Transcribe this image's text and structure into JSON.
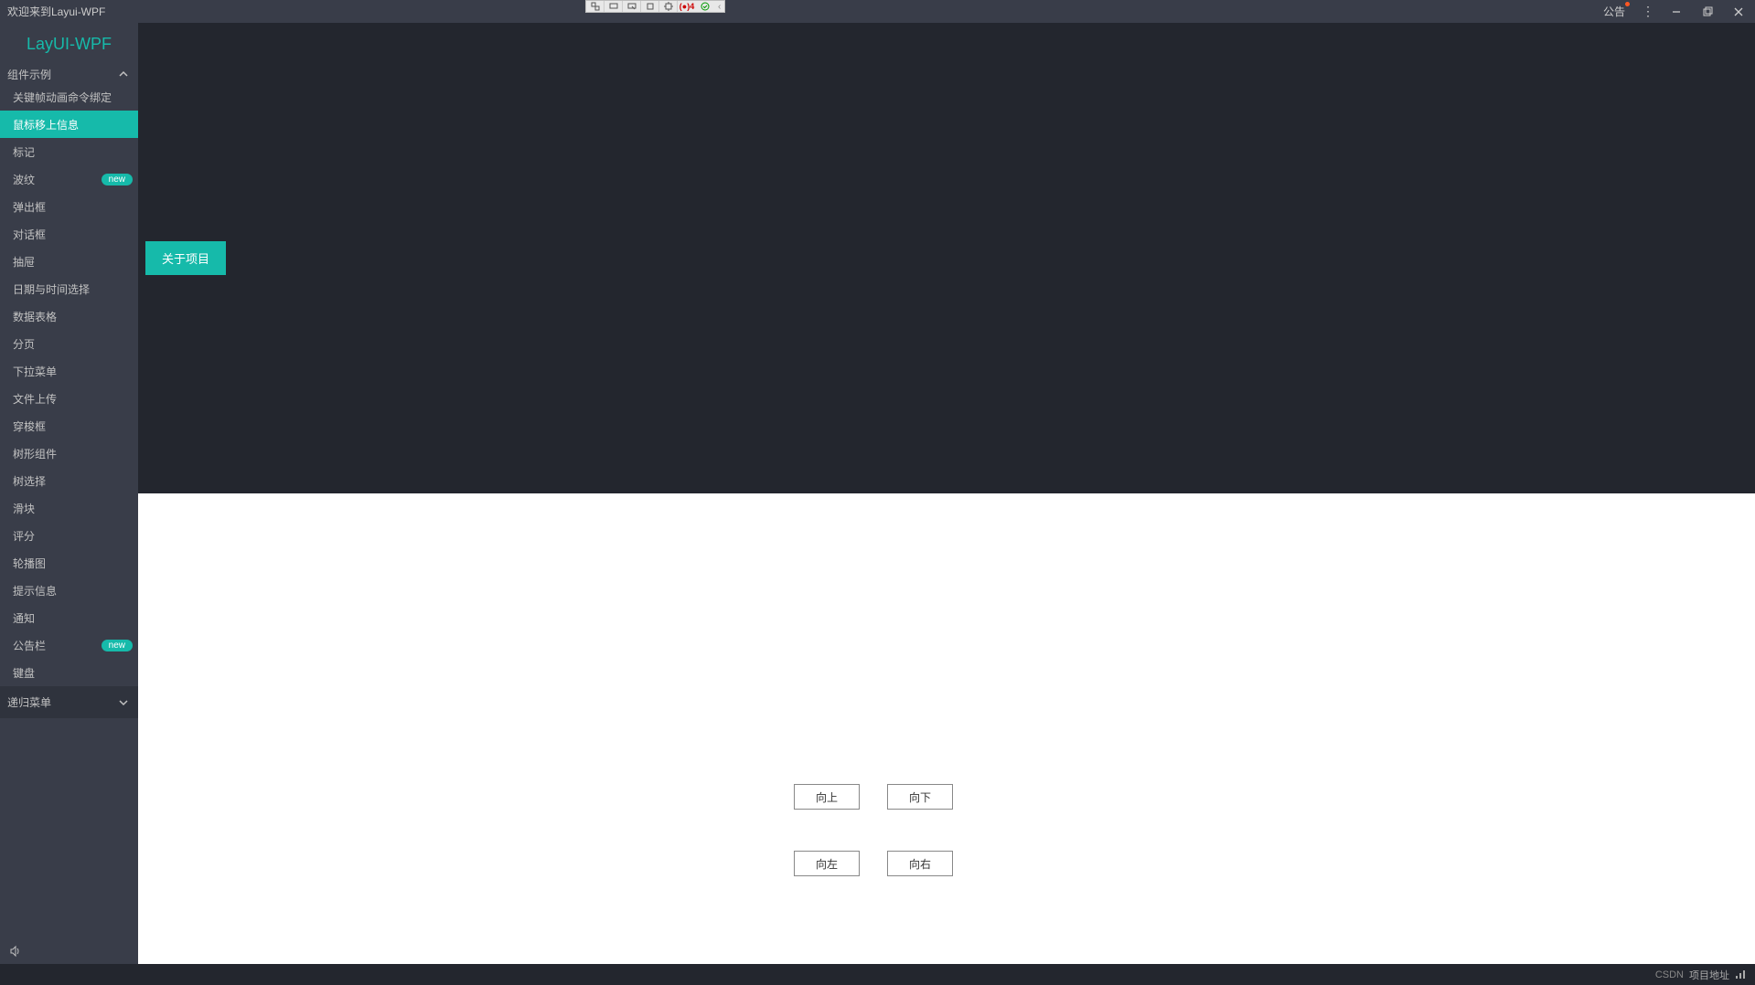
{
  "titlebar": {
    "title": "欢迎来到Layui-WPF",
    "announce": "公告",
    "debug_count": "4"
  },
  "brand": "LayUI-WPF",
  "header": {
    "about": "关于项目"
  },
  "sidebar": {
    "group_label": "组件示例",
    "items": [
      {
        "label": "关键帧动画命令绑定",
        "active": false
      },
      {
        "label": "鼠标移上信息",
        "active": true
      },
      {
        "label": "标记",
        "active": false
      },
      {
        "label": "波纹",
        "active": false,
        "badge": "new"
      },
      {
        "label": "弹出框",
        "active": false
      },
      {
        "label": "对话框",
        "active": false
      },
      {
        "label": "抽屉",
        "active": false
      },
      {
        "label": "日期与时间选择",
        "active": false
      },
      {
        "label": "数据表格",
        "active": false
      },
      {
        "label": "分页",
        "active": false
      },
      {
        "label": "下拉菜单",
        "active": false
      },
      {
        "label": "文件上传",
        "active": false
      },
      {
        "label": "穿梭框",
        "active": false
      },
      {
        "label": "树形组件",
        "active": false
      },
      {
        "label": "树选择",
        "active": false
      },
      {
        "label": "滑块",
        "active": false
      },
      {
        "label": "评分",
        "active": false
      },
      {
        "label": "轮播图",
        "active": false
      },
      {
        "label": "提示信息",
        "active": false
      },
      {
        "label": "通知",
        "active": false
      },
      {
        "label": "公告栏",
        "active": false,
        "badge": "new"
      },
      {
        "label": "键盘",
        "active": false
      }
    ],
    "group2_label": "递归菜单"
  },
  "content": {
    "buttons": {
      "up": "向上",
      "down": "向下",
      "left": "向左",
      "right": "向右"
    }
  },
  "footer": {
    "csdn": "CSDN",
    "project_link": "项目地址"
  }
}
